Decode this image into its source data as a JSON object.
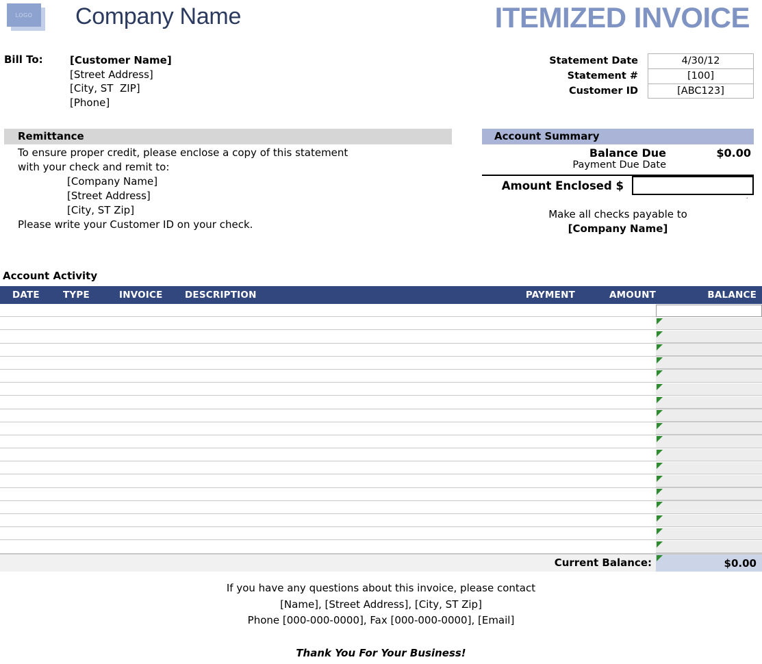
{
  "header": {
    "logo_text": "LOGO",
    "company_name": "Company Name",
    "doc_title": "ITEMIZED INVOICE"
  },
  "bill_to": {
    "label": "Bill To:",
    "lines": [
      "[Customer Name]",
      "[Street Address]",
      "[City, ST  ZIP]",
      "[Phone]"
    ]
  },
  "statement_meta": [
    {
      "label": "Statement Date",
      "value": "4/30/12"
    },
    {
      "label": "Statement #",
      "value": "[100]"
    },
    {
      "label": "Customer ID",
      "value": "[ABC123]"
    }
  ],
  "remittance": {
    "heading": "Remittance",
    "line1": "To ensure proper credit, please enclose a copy of this statement",
    "line2": "with your check and remit to:",
    "address": [
      "[Company Name]",
      "[Street Address]",
      "[City, ST  Zip]"
    ],
    "note": "Please write your Customer ID on your check."
  },
  "account_summary": {
    "heading": "Account Summary",
    "balance_due_label": "Balance Due",
    "balance_due_value": "$0.00",
    "payment_due_date_label": "Payment Due Date",
    "payment_due_date_value": "",
    "amount_enclosed_label": "Amount Enclosed $",
    "amount_enclosed_value": "",
    "dot": "·",
    "payable_line1": "Make all checks payable to",
    "payable_line2": "[Company Name]"
  },
  "account_activity": {
    "title": "Account Activity",
    "columns": [
      "DATE",
      "TYPE",
      "INVOICE",
      "DESCRIPTION",
      "PAYMENT",
      "AMOUNT",
      "BALANCE"
    ],
    "rows": [
      {
        "date": "",
        "type": "",
        "invoice": "",
        "description": "",
        "payment": "",
        "amount": "",
        "balance": ""
      },
      {
        "date": "",
        "type": "",
        "invoice": "",
        "description": "",
        "payment": "",
        "amount": "",
        "balance": ""
      },
      {
        "date": "",
        "type": "",
        "invoice": "",
        "description": "",
        "payment": "",
        "amount": "",
        "balance": ""
      },
      {
        "date": "",
        "type": "",
        "invoice": "",
        "description": "",
        "payment": "",
        "amount": "",
        "balance": ""
      },
      {
        "date": "",
        "type": "",
        "invoice": "",
        "description": "",
        "payment": "",
        "amount": "",
        "balance": ""
      },
      {
        "date": "",
        "type": "",
        "invoice": "",
        "description": "",
        "payment": "",
        "amount": "",
        "balance": ""
      },
      {
        "date": "",
        "type": "",
        "invoice": "",
        "description": "",
        "payment": "",
        "amount": "",
        "balance": ""
      },
      {
        "date": "",
        "type": "",
        "invoice": "",
        "description": "",
        "payment": "",
        "amount": "",
        "balance": ""
      },
      {
        "date": "",
        "type": "",
        "invoice": "",
        "description": "",
        "payment": "",
        "amount": "",
        "balance": ""
      },
      {
        "date": "",
        "type": "",
        "invoice": "",
        "description": "",
        "payment": "",
        "amount": "",
        "balance": ""
      },
      {
        "date": "",
        "type": "",
        "invoice": "",
        "description": "",
        "payment": "",
        "amount": "",
        "balance": ""
      },
      {
        "date": "",
        "type": "",
        "invoice": "",
        "description": "",
        "payment": "",
        "amount": "",
        "balance": ""
      },
      {
        "date": "",
        "type": "",
        "invoice": "",
        "description": "",
        "payment": "",
        "amount": "",
        "balance": ""
      },
      {
        "date": "",
        "type": "",
        "invoice": "",
        "description": "",
        "payment": "",
        "amount": "",
        "balance": ""
      },
      {
        "date": "",
        "type": "",
        "invoice": "",
        "description": "",
        "payment": "",
        "amount": "",
        "balance": ""
      },
      {
        "date": "",
        "type": "",
        "invoice": "",
        "description": "",
        "payment": "",
        "amount": "",
        "balance": ""
      },
      {
        "date": "",
        "type": "",
        "invoice": "",
        "description": "",
        "payment": "",
        "amount": "",
        "balance": ""
      },
      {
        "date": "",
        "type": "",
        "invoice": "",
        "description": "",
        "payment": "",
        "amount": "",
        "balance": ""
      },
      {
        "date": "",
        "type": "",
        "invoice": "",
        "description": "",
        "payment": "",
        "amount": "",
        "balance": ""
      }
    ],
    "current_balance_label": "Current Balance:",
    "current_balance_value": "$0.00"
  },
  "footer": {
    "line1": "If you have any questions about this invoice, please contact",
    "line2": "[Name], [Street Address], [City, ST  Zip]",
    "line3": "Phone [000-000-0000], Fax [000-000-0000], [Email]",
    "thanks": "Thank You For Your Business!"
  },
  "colors": {
    "title_blue": "#8094c4",
    "company_navy": "#2b3a5e",
    "table_header_navy": "#33477f",
    "summary_header_blue": "#aab4d6",
    "remit_header_gray": "#d6d6d6",
    "balance_cell_blue": "#ccd4e8",
    "row_balance_gray": "#ededed",
    "triangle_green": "#2e8b30"
  }
}
